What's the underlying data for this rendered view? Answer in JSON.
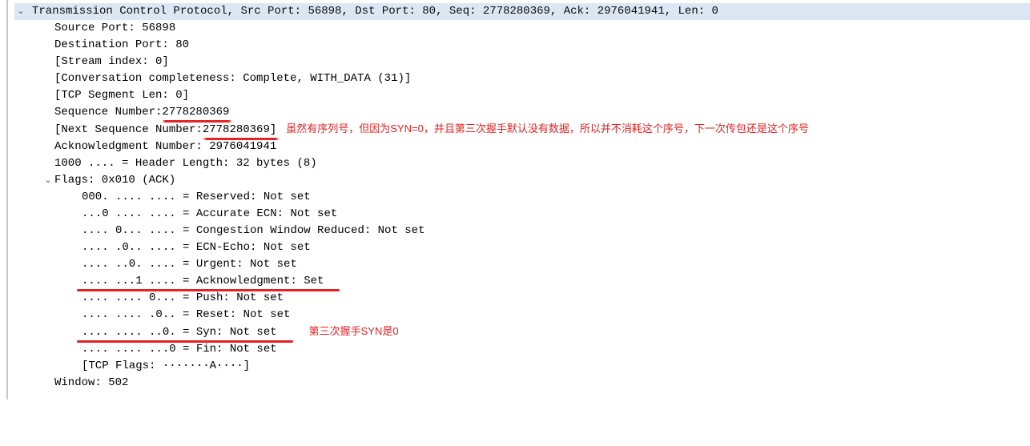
{
  "header": "Transmission Control Protocol, Src Port: 56898, Dst Port: 80, Seq: 2778280369, Ack: 2976041941, Len: 0",
  "fields": {
    "src_port": "Source Port: 56898",
    "dst_port": "Destination Port: 80",
    "stream_index": "[Stream index: 0]",
    "conv_complete": "[Conversation completeness: Complete, WITH_DATA (31)]",
    "tcp_seg_len": "[TCP Segment Len: 0]",
    "seq_label": "Sequence Number: ",
    "seq_value": "2778280369",
    "next_seq_prefix": "[Next Sequence Number: ",
    "next_seq_value": "2778280369]",
    "ack_num": "Acknowledgment Number: 2976041941",
    "header_len": "1000 .... = Header Length: 32 bytes (8)",
    "flags_summary": "Flags: 0x010 (ACK)",
    "window": "Window: 502"
  },
  "flags": {
    "reserved": "000. .... .... = Reserved: Not set",
    "acc_ecn": "...0 .... .... = Accurate ECN: Not set",
    "cwr": ".... 0... .... = Congestion Window Reduced: Not set",
    "ecn_echo": ".... .0.. .... = ECN-Echo: Not set",
    "urgent": ".... ..0. .... = Urgent: Not set",
    "ack": ".... ...1 .... = Acknowledgment: Set",
    "push": ".... .... 0... = Push: Not set",
    "reset": ".... .... .0.. = Reset: Not set",
    "syn": ".... .... ..0. = Syn: Not set",
    "fin": ".... .... ...0 = Fin: Not set",
    "tcp_flags": "[TCP Flags: ·······A····]"
  },
  "annotations": {
    "next_seq": "虽然有序列号，但因为SYN=0，并且第三次握手默认没有数据，所以并不消耗这个序号，下一次传包还是这个序号",
    "syn": "第三次握手SYN是0"
  }
}
